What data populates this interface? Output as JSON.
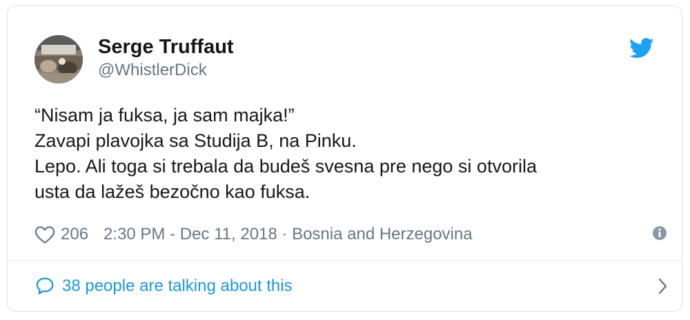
{
  "author": {
    "display_name": "Serge Truffaut",
    "handle": "@WhistlerDick"
  },
  "tweet": {
    "lines": [
      "“Nisam ja fuksa, ja sam majka!”",
      "Zavapi plavojka sa Studija B, na Pinku.",
      "Lepo. Ali toga si trebala da budeš svesna pre nego si otvorila",
      "usta da lažeš bezočno kao fuksa."
    ]
  },
  "meta": {
    "likes": "206",
    "timestamp": "2:30 PM - Dec 11, 2018 · Bosnia and Herzegovina"
  },
  "footer": {
    "conversation_label": "38 people are talking about this"
  },
  "icons": {
    "brand": "twitter-bird-icon",
    "like": "heart-icon",
    "info": "info-icon",
    "reply": "speech-bubble-icon",
    "more": "chevron-right-icon"
  },
  "colors": {
    "brand": "#1da1f2",
    "link": "#1b95e0",
    "text": "#14171a",
    "muted": "#657786",
    "border": "#e1e8ed"
  }
}
